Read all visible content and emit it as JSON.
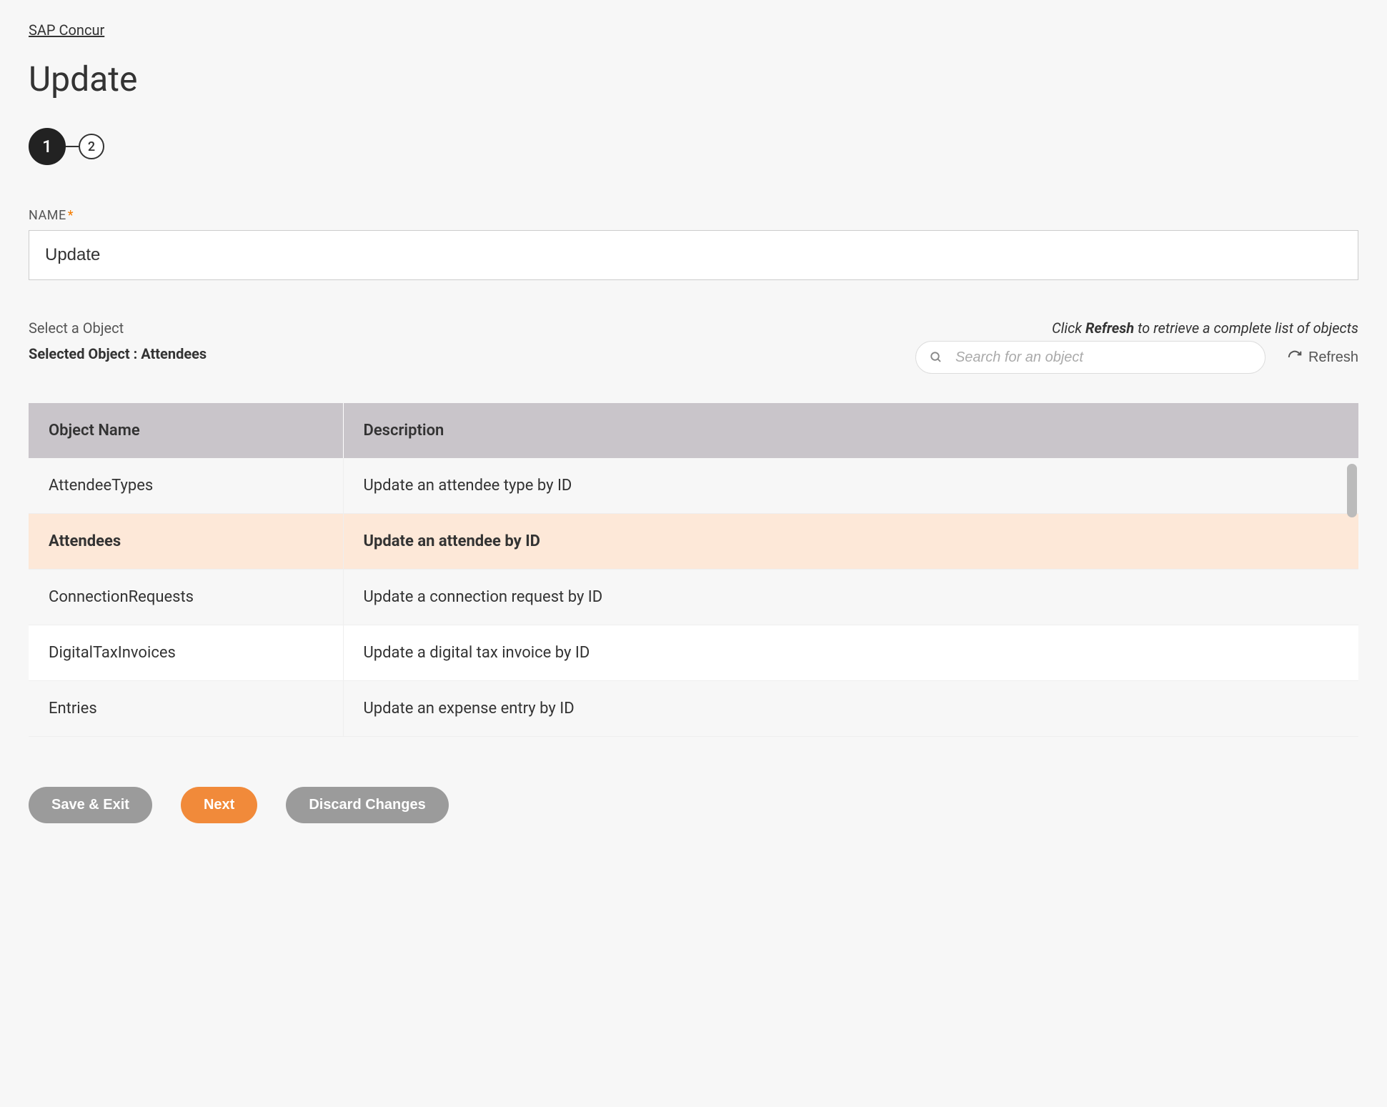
{
  "breadcrumb": "SAP Concur",
  "page_title": "Update",
  "stepper": {
    "current": "1",
    "next": "2"
  },
  "name_field": {
    "label": "NAME",
    "value": "Update"
  },
  "object_section": {
    "select_label": "Select a Object",
    "selected_prefix": "Selected Object : ",
    "selected_value": "Attendees",
    "refresh_hint_prefix": "Click ",
    "refresh_hint_bold": "Refresh",
    "refresh_hint_suffix": " to retrieve a complete list of objects",
    "search_placeholder": "Search for an object",
    "refresh_label": "Refresh"
  },
  "table": {
    "headers": {
      "name": "Object Name",
      "description": "Description"
    },
    "rows": [
      {
        "name": "AttendeeTypes",
        "description": "Update an attendee type by ID",
        "selected": false
      },
      {
        "name": "Attendees",
        "description": "Update an attendee by ID",
        "selected": true
      },
      {
        "name": "ConnectionRequests",
        "description": "Update a connection request by ID",
        "selected": false
      },
      {
        "name": "DigitalTaxInvoices",
        "description": "Update a digital tax invoice by ID",
        "selected": false
      },
      {
        "name": "Entries",
        "description": "Update an expense entry by ID",
        "selected": false
      }
    ]
  },
  "buttons": {
    "save_exit": "Save & Exit",
    "next": "Next",
    "discard": "Discard Changes"
  }
}
